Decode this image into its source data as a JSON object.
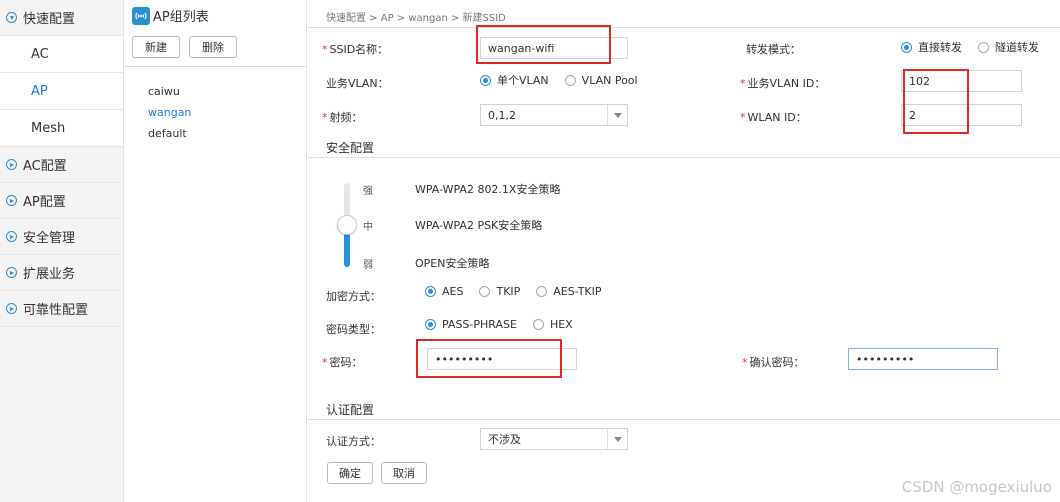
{
  "sidebar": {
    "quick_config": "快速配置",
    "sub_items": [
      "AC",
      "AP",
      "Mesh"
    ],
    "items": [
      "AC配置",
      "AP配置",
      "安全管理",
      "扩展业务",
      "可靠性配置"
    ]
  },
  "group_panel": {
    "title": "AP组列表",
    "new_label": "新建",
    "delete_label": "删除",
    "groups": [
      "caiwu",
      "wangan",
      "default"
    ]
  },
  "breadcrumb": "快速配置 > AP > wangan > 新建SSID",
  "form": {
    "ssid_label": "SSID名称：",
    "ssid_value": "wangan-wifi",
    "forward_label": "转发模式：",
    "forward_opt1": "直接转发",
    "forward_opt2": "隧道转发",
    "vlan_label": "业务VLAN：",
    "vlan_opt1": "单个VLAN",
    "vlan_opt2": "VLAN Pool",
    "vlan_id_label": "业务VLAN ID：",
    "vlan_id_value": "102",
    "radio_label": "射频：",
    "radio_value": "0,1,2",
    "wlan_id_label": "WLAN ID：",
    "wlan_id_value": "2"
  },
  "security": {
    "title": "安全配置",
    "level_strong": "强",
    "level_mid": "中",
    "level_weak": "弱",
    "policy_strong": "WPA-WPA2 802.1X安全策略",
    "policy_mid": "WPA-WPA2 PSK安全策略",
    "policy_weak": "OPEN安全策略",
    "slider_level": 0.5,
    "encrypt_label": "加密方式：",
    "encrypt_opt1": "AES",
    "encrypt_opt2": "TKIP",
    "encrypt_opt3": "AES-TKIP",
    "keytype_label": "密码类型：",
    "keytype_opt1": "PASS-PHRASE",
    "keytype_opt2": "HEX",
    "password_label": "密码：",
    "password_value": "•••••••••",
    "confirm_label": "确认密码：",
    "confirm_value": "•••••••••"
  },
  "auth": {
    "title": "认证配置",
    "method_label": "认证方式：",
    "method_value": "不涉及",
    "ok_label": "确定",
    "cancel_label": "取消"
  },
  "watermark": "CSDN @mogexiuluo",
  "colors": {
    "accent": "#2b8fd8",
    "highlight": "#e02a2a"
  }
}
